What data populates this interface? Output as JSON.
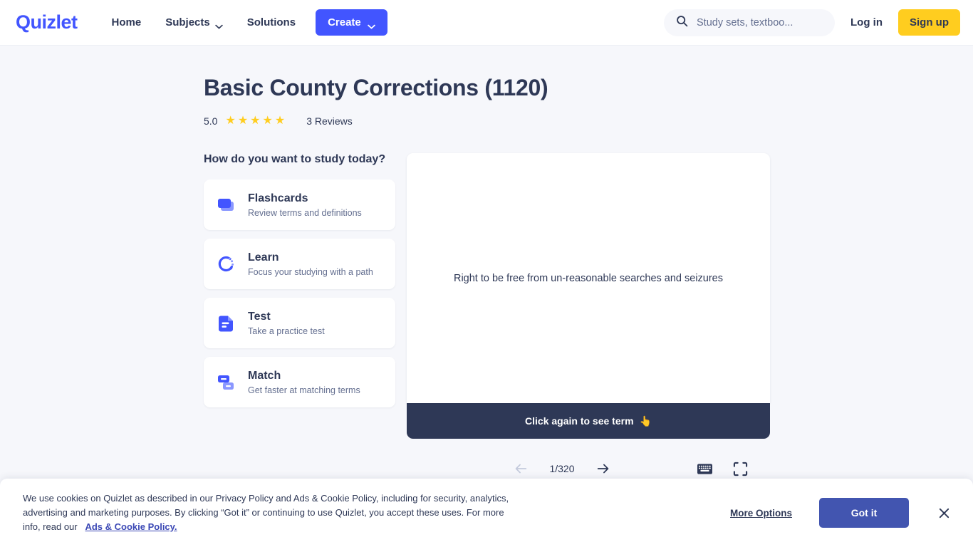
{
  "header": {
    "logo": "Quizlet",
    "nav": [
      {
        "label": "Home",
        "has_chevron": false
      },
      {
        "label": "Subjects",
        "has_chevron": true
      },
      {
        "label": "Solutions",
        "has_chevron": false
      }
    ],
    "create_label": "Create",
    "search_placeholder": "Study sets, textboo...",
    "login_label": "Log in",
    "signup_label": "Sign up",
    "brand_color": "#4255ff",
    "signup_color": "#ffcd1f"
  },
  "set": {
    "title": "Basic County Corrections (1120)",
    "rating_value": "5.0",
    "star_count": 5,
    "star_glyph": "★",
    "reviews_label": "3 Reviews",
    "star_color": "#ffcd1f"
  },
  "study": {
    "heading": "How do you want to study today?",
    "modes": [
      {
        "icon": "flashcards-icon",
        "title": "Flashcards",
        "subtitle": "Review terms and definitions"
      },
      {
        "icon": "learn-icon",
        "title": "Learn",
        "subtitle": "Focus your studying with a path"
      },
      {
        "icon": "test-icon",
        "title": "Test",
        "subtitle": "Take a practice test"
      },
      {
        "icon": "match-icon",
        "title": "Match",
        "subtitle": "Get faster at matching terms"
      }
    ]
  },
  "flashcard": {
    "text": "Right to be free from un-reasonable searches and seizures",
    "footer_label": "Click again to see term",
    "footer_emoji": "👆",
    "footer_bg": "#2e3856",
    "counter": "1/320",
    "prev_icon": "arrow-left-icon",
    "next_icon": "arrow-right-icon",
    "keyboard_icon": "keyboard-icon",
    "fullscreen_icon": "fullscreen-icon"
  },
  "cookie_banner": {
    "text_part1": "We use cookies on Quizlet as described in our Privacy Policy and Ads & Cookie Policy, including for security, analytics, advertising and marketing purposes. By clicking “Got it” or continuing to use Quizlet, you accept these uses. For more info, read our",
    "link_label": "Ads & Cookie Policy.",
    "more_options_label": "More Options",
    "got_it_label": "Got it",
    "got_it_color": "#4255b0",
    "close_icon": "close-icon"
  }
}
